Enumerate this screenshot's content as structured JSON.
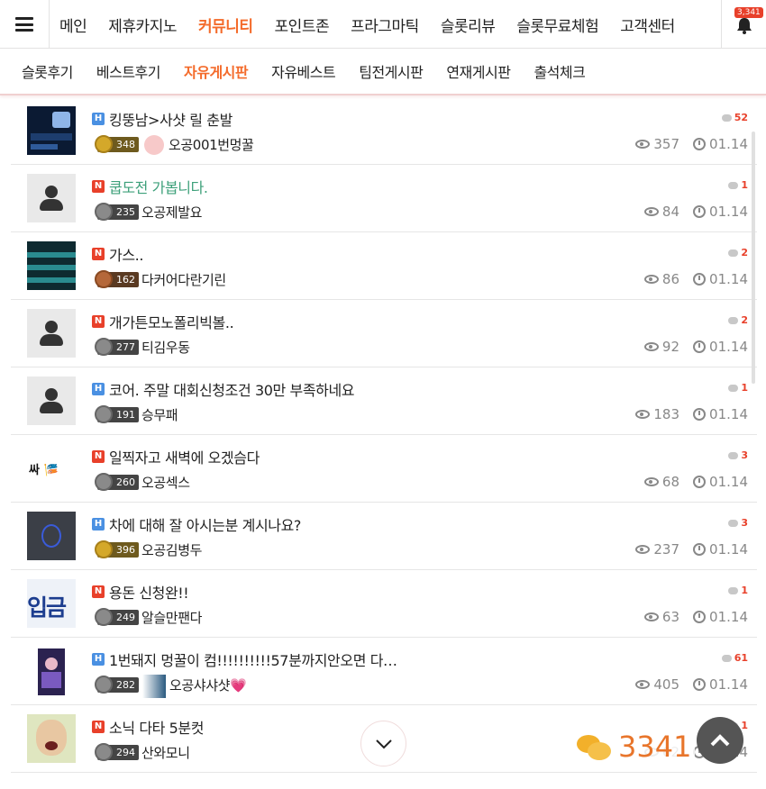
{
  "topnav": {
    "items": [
      "메인",
      "제휴카지노",
      "커뮤니티",
      "포인트존",
      "프라그마틱",
      "슬롯리뷰",
      "슬롯무료체험",
      "고객센터"
    ],
    "active_index": 2,
    "notification_count": "3,341"
  },
  "subnav": {
    "items": [
      "슬롯후기",
      "베스트후기",
      "자유게시판",
      "자유베스트",
      "팀전게시판",
      "연재게시판",
      "출석체크"
    ],
    "active_index": 2
  },
  "posts": [
    {
      "tag": "H",
      "title": "킹뚱남>사샷 릴 춘발",
      "comments": "52",
      "level": "348",
      "author": "오공001번멍꿀",
      "views": "357",
      "date": "01.14"
    },
    {
      "tag": "N",
      "title": "쿱도전 가봅니다.",
      "comments": "1",
      "level": "235",
      "author": "오공제발요",
      "views": "84",
      "date": "01.14"
    },
    {
      "tag": "N",
      "title": "가스..",
      "comments": "2",
      "level": "162",
      "author": "다커어다란기린",
      "views": "86",
      "date": "01.14"
    },
    {
      "tag": "N",
      "title": "개가튼모노폴리빅볼..",
      "comments": "2",
      "level": "277",
      "author": "티김우동",
      "views": "92",
      "date": "01.14"
    },
    {
      "tag": "H",
      "title": "코어. 주말 대회신청조건 30만 부족하네요",
      "comments": "1",
      "level": "191",
      "author": "승무패",
      "views": "183",
      "date": "01.14"
    },
    {
      "tag": "N",
      "title": "일찍자고 새벽에 오겠슴다",
      "comments": "3",
      "level": "260",
      "author": "오공섹스",
      "views": "68",
      "date": "01.14"
    },
    {
      "tag": "H",
      "title": "차에 대해 잘 아시는분 계시나요?",
      "comments": "3",
      "level": "396",
      "author": "오공김병두",
      "views": "237",
      "date": "01.14"
    },
    {
      "tag": "N",
      "title": "용돈 신청완!!",
      "comments": "1",
      "level": "249",
      "author": "알슬만팬다",
      "views": "63",
      "date": "01.14"
    },
    {
      "tag": "H",
      "title": "1번돼지 멍꿀이 컴!!!!!!!!!!57분까지안오면 다…",
      "comments": "61",
      "level": "282",
      "author": "오공샤샤샷💗",
      "views": "405",
      "date": "01.14"
    },
    {
      "tag": "N",
      "title": "소닉 다타 5분컷",
      "comments": "1",
      "level": "294",
      "author": "산와모니",
      "views": "62",
      "date": "01.14"
    }
  ],
  "thumb_text": {
    "row6": "싸  🎏",
    "row8": "입금"
  },
  "chat": {
    "count": "3341"
  },
  "colors": {
    "accent": "#f46b2b",
    "hot_tag": "#4a90e2",
    "new_tag": "#e8402a",
    "chat": "#e8752b"
  }
}
